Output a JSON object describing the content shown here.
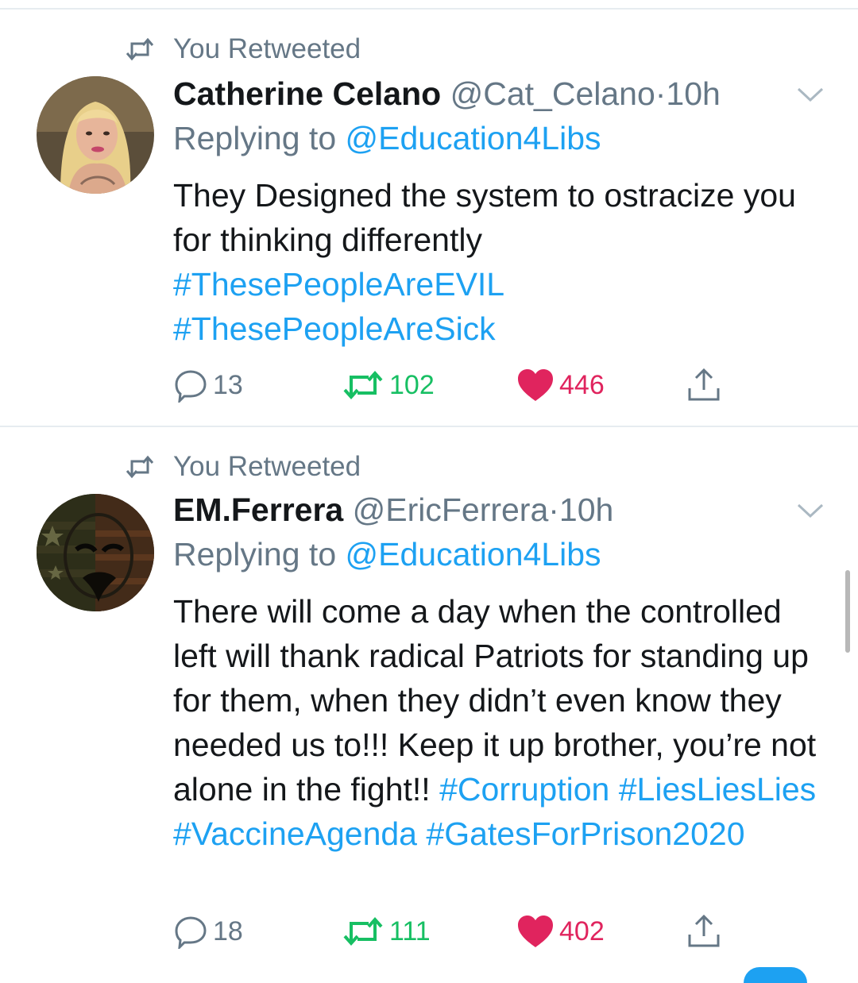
{
  "tweets": [
    {
      "retweet_label": "You Retweeted",
      "display_name": "Catherine Celano",
      "handle": "@Cat_Celano",
      "dot": "·",
      "time": "10h",
      "replying_prefix": "Replying to",
      "replying_to": "@Education4Libs",
      "text": "They Designed the system to ostracize you for thinking differently",
      "hashtags": [
        "#ThesePeopleAreEVIL",
        "#ThesePeopleAreSick"
      ],
      "replies": "13",
      "retweets": "102",
      "likes": "446"
    },
    {
      "retweet_label": "You Retweeted",
      "display_name": "EM.Ferrera",
      "handle": "@EricFerrera",
      "dot": "·",
      "time": "10h",
      "replying_prefix": "Replying to",
      "replying_to": "@Education4Libs",
      "text": "There will come a day when the controlled left will thank radical Patriots for standing up for them, when they didn’t even know they needed us to!!! Keep it up brother, you’re not alone in the fight!!",
      "hashtags": [
        "#Corruption",
        "#LiesLiesLies",
        "#VaccineAgenda",
        "#GatesForPrison2020"
      ],
      "replies": "18",
      "retweets": "111",
      "likes": "402"
    }
  ],
  "colors": {
    "link": "#1da1f2",
    "muted": "#657786",
    "retweet_green": "#17bf63",
    "like_red": "#e0245e"
  },
  "icons": [
    "retweet-icon",
    "caret-down-icon",
    "reply-icon",
    "heart-icon",
    "share-icon"
  ]
}
